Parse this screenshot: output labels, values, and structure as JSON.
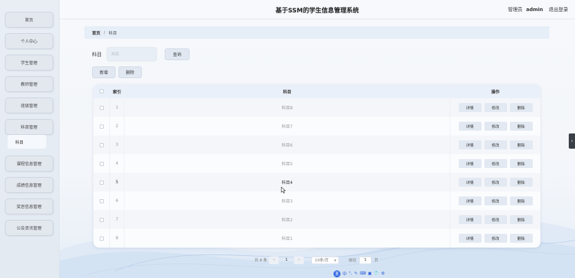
{
  "header": {
    "title": "基于SSM的学生信息管理系统",
    "role": "管理员",
    "username": "admin",
    "logout": "退出登录"
  },
  "sidebar": {
    "items": [
      "首页",
      "个人中心",
      "学生管理",
      "教师管理",
      "班级管理",
      "科目管理",
      "课程信息管理",
      "成绩信息管理",
      "奖惩信息管理",
      "公告资讯管理"
    ],
    "submenu_item": "科目"
  },
  "breadcrumb": {
    "home": "首页",
    "separator": "/",
    "current": "科目"
  },
  "search": {
    "label": "科目",
    "placeholder": "科目",
    "button": "查询"
  },
  "actions": {
    "add": "新增",
    "delete": "删除"
  },
  "table": {
    "headers": {
      "index": "索引",
      "subject": "科目",
      "actions": "操作"
    },
    "rows": [
      {
        "index": "1",
        "subject": "科目8"
      },
      {
        "index": "2",
        "subject": "科目7"
      },
      {
        "index": "3",
        "subject": "科目6"
      },
      {
        "index": "4",
        "subject": "科目5"
      },
      {
        "index": "5",
        "subject": "科目4"
      },
      {
        "index": "6",
        "subject": "科目3"
      },
      {
        "index": "7",
        "subject": "科目2"
      },
      {
        "index": "8",
        "subject": "科目1"
      }
    ],
    "row_actions": {
      "detail": "详情",
      "edit": "修改",
      "delete": "删除"
    }
  },
  "pagination": {
    "total": "共 8 条",
    "prev": "<",
    "current_page": "1",
    "next": ">",
    "page_size": "10条/页",
    "goto_label": "前往",
    "goto_value": "1",
    "goto_suffix": "页"
  },
  "ime_toolbar": {
    "logo": "王",
    "items": [
      "中",
      "°,",
      "✎",
      "⌨",
      "▣",
      "👕",
      "⚙"
    ]
  },
  "colors": {
    "accent": "#2a62e0",
    "header_bg": "#eaf0fa",
    "button_bg": "#e1e8f2"
  }
}
